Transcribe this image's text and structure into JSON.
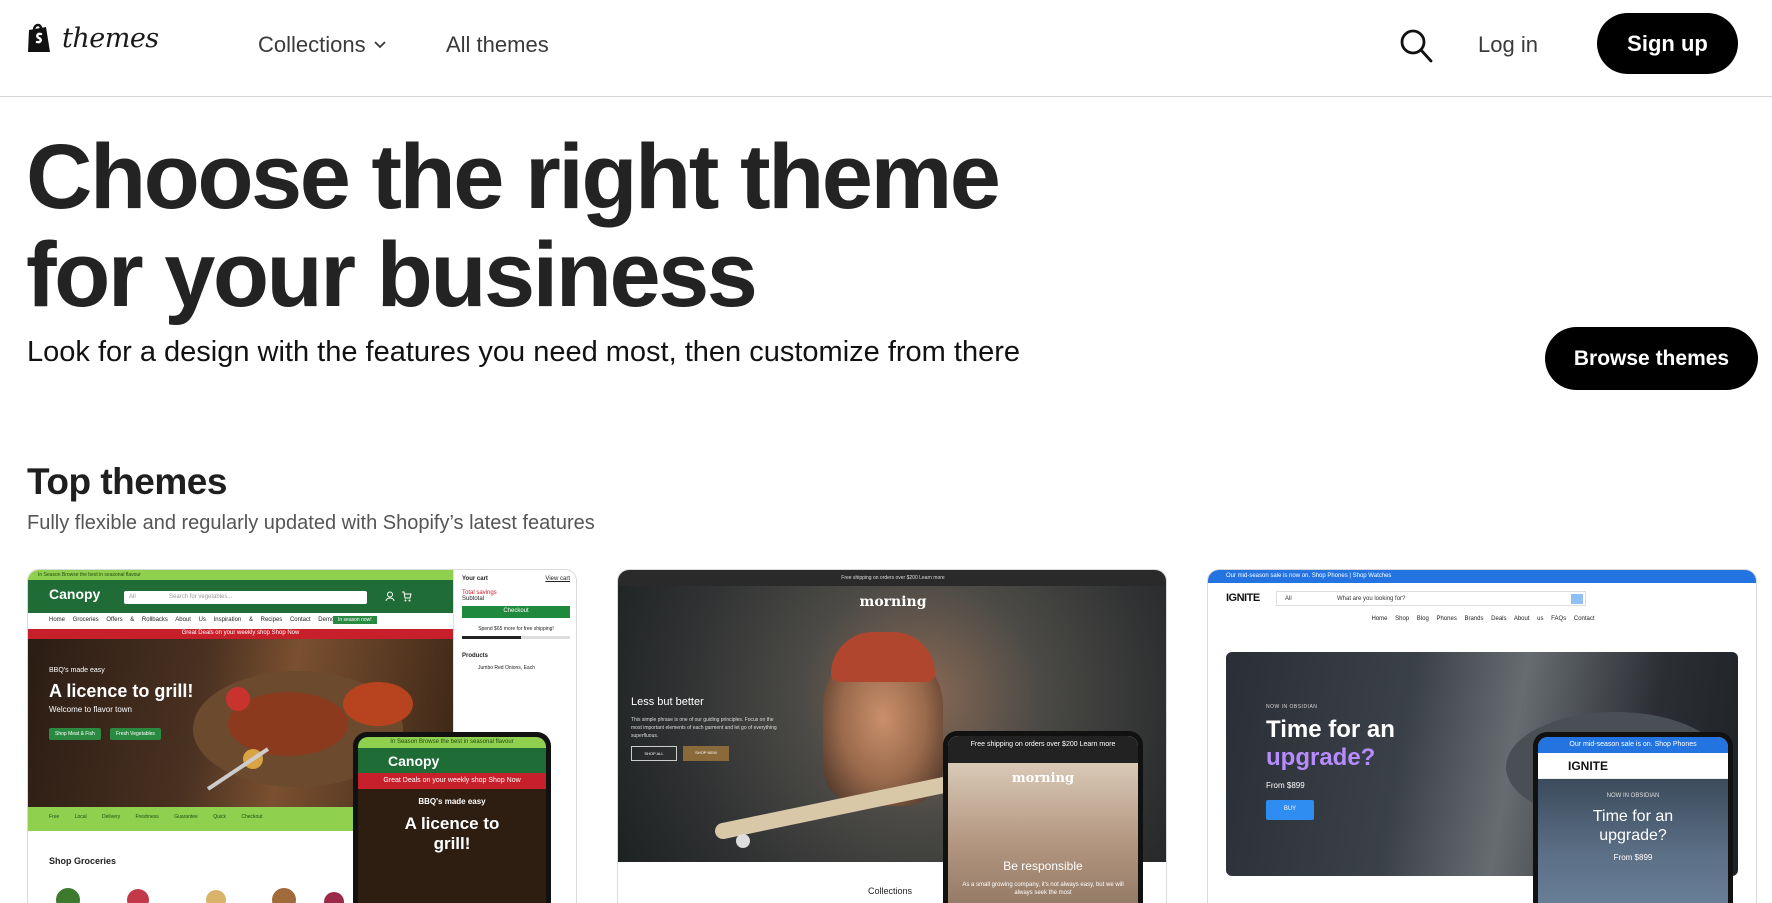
{
  "header": {
    "logo_word": "themes",
    "nav": {
      "collections": "Collections",
      "all_themes": "All themes"
    },
    "login": "Log in",
    "signup": "Sign up"
  },
  "hero": {
    "title_line1": "Choose the right theme",
    "title_line2": "for your business",
    "subtitle": "Look for a design with the features you need most, then customize from there",
    "browse_button": "Browse themes"
  },
  "top_themes": {
    "title": "Top themes",
    "subtitle": "Fully flexible and regularly updated with Shopify’s latest features"
  },
  "cards": {
    "canopy": {
      "topbar": "In Season Browse the best in seasonal flavour",
      "logo": "Canopy",
      "search_category": "All",
      "search_placeholder": "Search for vegetables...",
      "menu": "Home Groceries Offers & Rollbacks About Us Inspiration & Recipes Contact Demos",
      "in_season": "In season now!",
      "deal": "Great Deals on your weekly shop Shop Now",
      "hero_small": "BBQ's made easy",
      "hero_big": "A licence to grill!",
      "hero_welcome": "Welcome to flavor town",
      "btn_meat": "Shop Meat & Fish",
      "btn_veg": "Fresh Vegetables",
      "features": "Free Local Delivery Freshness Guarantee Quick Checkout",
      "shop_groceries": "Shop Groceries",
      "cart_title": "Your cart",
      "cart_view": "View cart",
      "total_savings": "Total savings",
      "subtotal": "Subtotal",
      "checkout": "Checkout",
      "spend_note": "Spend $65 more for free shipping!",
      "products": "Products",
      "product_item": "Jumbo Red Onions, Each",
      "phone_top": "In Season Browse the best in seasonal flavour",
      "phone_logo": "Canopy",
      "phone_deal": "Great Deals on your weekly shop Shop Now",
      "phone_small": "BBQ's made easy",
      "phone_big": "A licence to grill!"
    },
    "morning": {
      "topbar": "Free shipping on orders over $200 Learn more",
      "logo": "morning",
      "headline": "Less but better",
      "description": "This simple phrase is one of our guiding principles. Focus on the most important elements of each garment and let go of everything superfluous.",
      "btn_shop_all": "SHOP ALL",
      "btn_shop_new": "SHOP NEW",
      "collections": "Collections",
      "phone_top": "Free shipping on orders over $200 Learn more",
      "phone_logo": "morning",
      "phone_headline": "Be responsible",
      "phone_text": "As a small growing company, it's not always easy, but we will always seek the most"
    },
    "ignite": {
      "topbar": "Our mid-season sale is now on. Shop Phones | Shop Watches",
      "logo": "IGNITE",
      "search_category": "All",
      "search_placeholder": "What are you looking for?",
      "menu": "Home Shop Blog Phones Brands Deals About us FAQs Contact",
      "now_in": "NOW IN OBSIDIAN",
      "headline1": "Time for an",
      "headline2": "upgrade?",
      "from": "From $899",
      "buy": "BUY",
      "phone_top": "Our mid-season sale is on. Shop Phones",
      "phone_logo": "IGNITE",
      "phone_now_in": "NOW IN OBSIDIAN",
      "phone_headline": "Time for an upgrade?",
      "phone_from": "From $899"
    }
  }
}
